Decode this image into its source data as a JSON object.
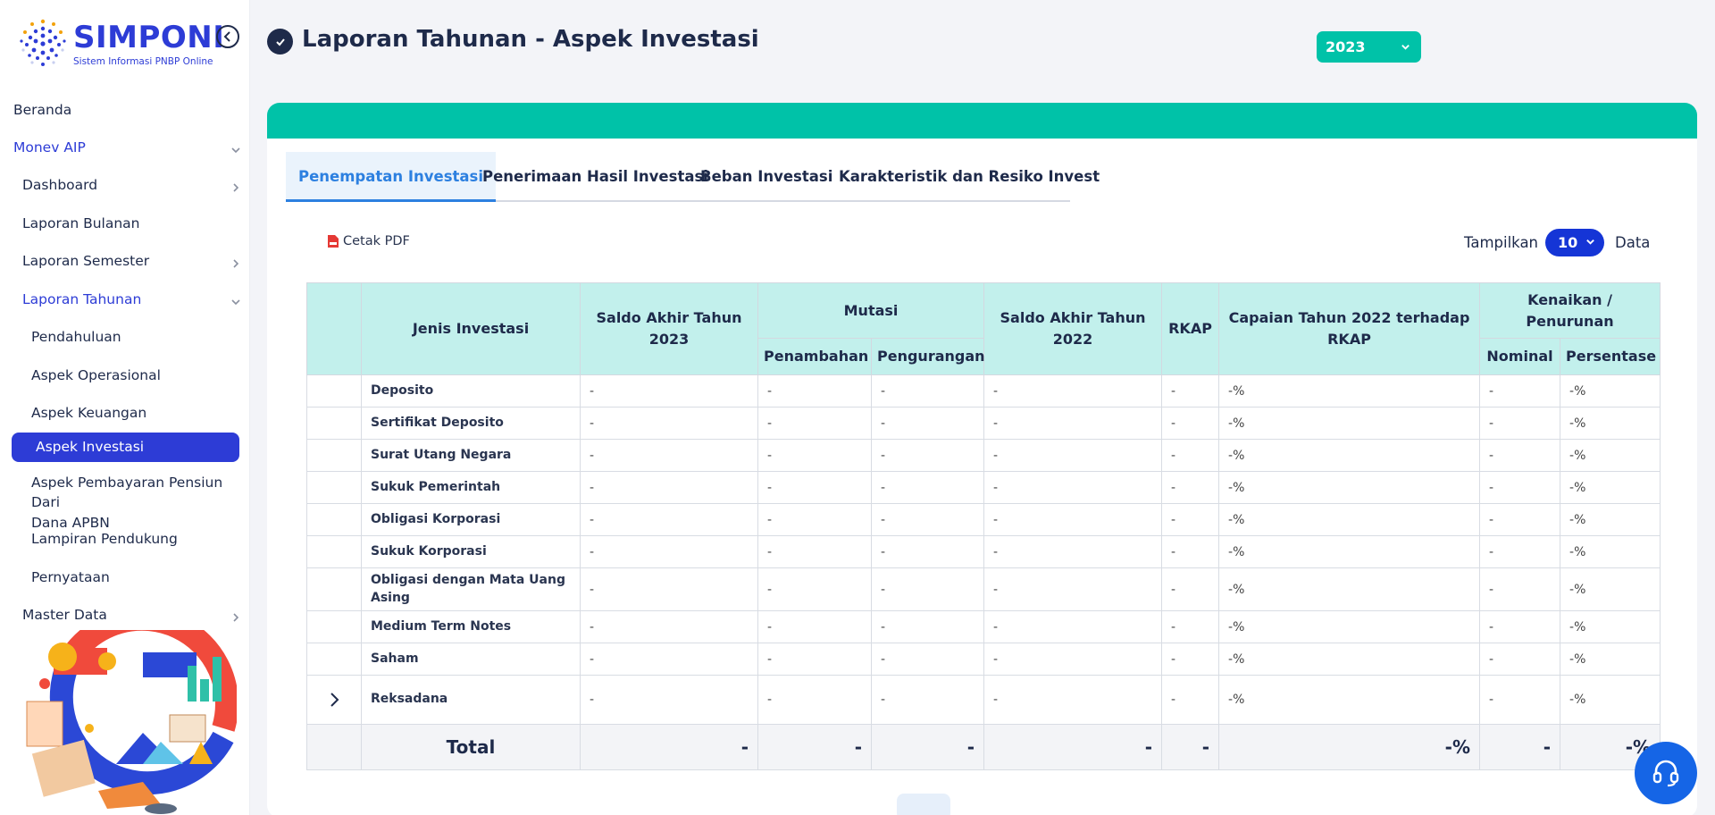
{
  "app": {
    "name": "SIMPONI",
    "tagline": "Sistem Informasi PNBP Online"
  },
  "sidebar": {
    "items": [
      {
        "label": "Beranda"
      },
      {
        "label": "Monev AIP"
      },
      {
        "label": "Dashboard"
      },
      {
        "label": "Laporan Bulanan"
      },
      {
        "label": "Laporan Semester"
      },
      {
        "label": "Laporan Tahunan"
      },
      {
        "label": "Pendahuluan"
      },
      {
        "label": "Aspek Operasional"
      },
      {
        "label": "Aspek Keuangan"
      },
      {
        "label": "Aspek Investasi"
      },
      {
        "label": "Aspek Pembayaran Pensiun Dari",
        "label2": "Dana APBN"
      },
      {
        "label": "Lampiran Pendukung"
      },
      {
        "label": "Pernyataan"
      },
      {
        "label": "Master Data"
      }
    ],
    "active": "Aspek Investasi"
  },
  "header": {
    "title": "Laporan Tahunan - Aspek Investasi",
    "year": "2023"
  },
  "tabs": [
    {
      "label": "Penempatan Investasi",
      "active": true
    },
    {
      "label": "Penerimaan Hasil Investasi"
    },
    {
      "label": "Beban Investasi"
    },
    {
      "label": "Karakteristik dan Resiko Invest"
    }
  ],
  "toolbar": {
    "cetak_label": "Cetak PDF",
    "tampilkan_label": "Tampilkan",
    "page_size": "10",
    "data_label": "Data"
  },
  "table": {
    "headers": {
      "jenis": "Jenis Investasi",
      "saldo_2023": "Saldo Akhir Tahun 2023",
      "mutasi": "Mutasi",
      "penambahan": "Penambahan",
      "pengurangan": "Pengurangan",
      "saldo_2022": "Saldo Akhir Tahun 2022",
      "rkap": "RKAP",
      "capaian": "Capaian Tahun 2022 terhadap RKAP",
      "kenaikan": "Kenaikan / Penurunan",
      "nominal": "Nominal",
      "persentase": "Persentase"
    },
    "rows": [
      {
        "name": "Deposito",
        "saldo2023": "-",
        "penambahan": "-",
        "pengurangan": "-",
        "saldo2022": "-",
        "rkap": "-",
        "capaian": "-%",
        "nominal": "-",
        "persen": "-%"
      },
      {
        "name": "Sertifikat Deposito",
        "saldo2023": "-",
        "penambahan": "-",
        "pengurangan": "-",
        "saldo2022": "-",
        "rkap": "-",
        "capaian": "-%",
        "nominal": "-",
        "persen": "-%"
      },
      {
        "name": "Surat Utang Negara",
        "saldo2023": "-",
        "penambahan": "-",
        "pengurangan": "-",
        "saldo2022": "-",
        "rkap": "-",
        "capaian": "-%",
        "nominal": "-",
        "persen": "-%"
      },
      {
        "name": "Sukuk Pemerintah",
        "saldo2023": "-",
        "penambahan": "-",
        "pengurangan": "-",
        "saldo2022": "-",
        "rkap": "-",
        "capaian": "-%",
        "nominal": "-",
        "persen": "-%"
      },
      {
        "name": "Obligasi Korporasi",
        "saldo2023": "-",
        "penambahan": "-",
        "pengurangan": "-",
        "saldo2022": "-",
        "rkap": "-",
        "capaian": "-%",
        "nominal": "-",
        "persen": "-%"
      },
      {
        "name": "Sukuk Korporasi",
        "saldo2023": "-",
        "penambahan": "-",
        "pengurangan": "-",
        "saldo2022": "-",
        "rkap": "-",
        "capaian": "-%",
        "nominal": "-",
        "persen": "-%"
      },
      {
        "name": "Obligasi dengan Mata Uang Asing",
        "saldo2023": "-",
        "penambahan": "-",
        "pengurangan": "-",
        "saldo2022": "-",
        "rkap": "-",
        "capaian": "-%",
        "nominal": "-",
        "persen": "-%"
      },
      {
        "name": "Medium Term Notes",
        "saldo2023": "-",
        "penambahan": "-",
        "pengurangan": "-",
        "saldo2022": "-",
        "rkap": "-",
        "capaian": "-%",
        "nominal": "-",
        "persen": "-%"
      },
      {
        "name": "Saham",
        "saldo2023": "-",
        "penambahan": "-",
        "pengurangan": "-",
        "saldo2022": "-",
        "rkap": "-",
        "capaian": "-%",
        "nominal": "-",
        "persen": "-%"
      },
      {
        "name": "Reksadana",
        "saldo2023": "-",
        "penambahan": "-",
        "pengurangan": "-",
        "saldo2022": "-",
        "rkap": "-",
        "capaian": "-%",
        "nominal": "-",
        "persen": "-%"
      }
    ],
    "total": {
      "label": "Total",
      "saldo2023": "-",
      "penambahan": "-",
      "pengurangan": "-",
      "saldo2022": "-",
      "rkap": "-",
      "capaian": "-%",
      "nominal": "-",
      "persen": "-%"
    }
  },
  "colors": {
    "brand": "#2d3cd6",
    "teal": "#00c2a8",
    "header_cell": "#c2f0ec",
    "active_tab": "#2d80e0"
  },
  "icons": [
    "collapse-icon",
    "check-icon",
    "chevron-down-icon",
    "chevron-right-icon",
    "pdf-icon",
    "headset-icon"
  ]
}
